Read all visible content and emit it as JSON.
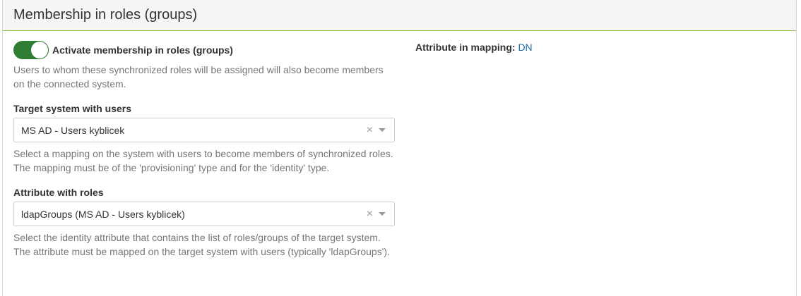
{
  "panel": {
    "title": "Membership in roles (groups)"
  },
  "toggle": {
    "label": "Activate membership in roles (groups)",
    "checked": true,
    "color": "#2e7d32",
    "help": "Users to whom these synchronized roles will be assigned will also become members on the connected system."
  },
  "target_system": {
    "label": "Target system with users",
    "value": "MS AD - Users kyblicek",
    "help": "Select a mapping on the system with users to become members of synchronized roles. The mapping must be of the 'provisioning' type and for the 'identity' type."
  },
  "attribute_roles": {
    "label": "Attribute with roles",
    "value": "ldapGroups (MS AD - Users kyblicek)",
    "help": "Select the identity attribute that contains the list of roles/groups of the target system. The attribute must be mapped on the target system with users (typically 'ldapGroups')."
  },
  "mapping_attribute": {
    "label": "Attribute in mapping:",
    "link": "DN"
  },
  "icons": {
    "clear": "×",
    "dropdown": "chevron-down-icon"
  }
}
